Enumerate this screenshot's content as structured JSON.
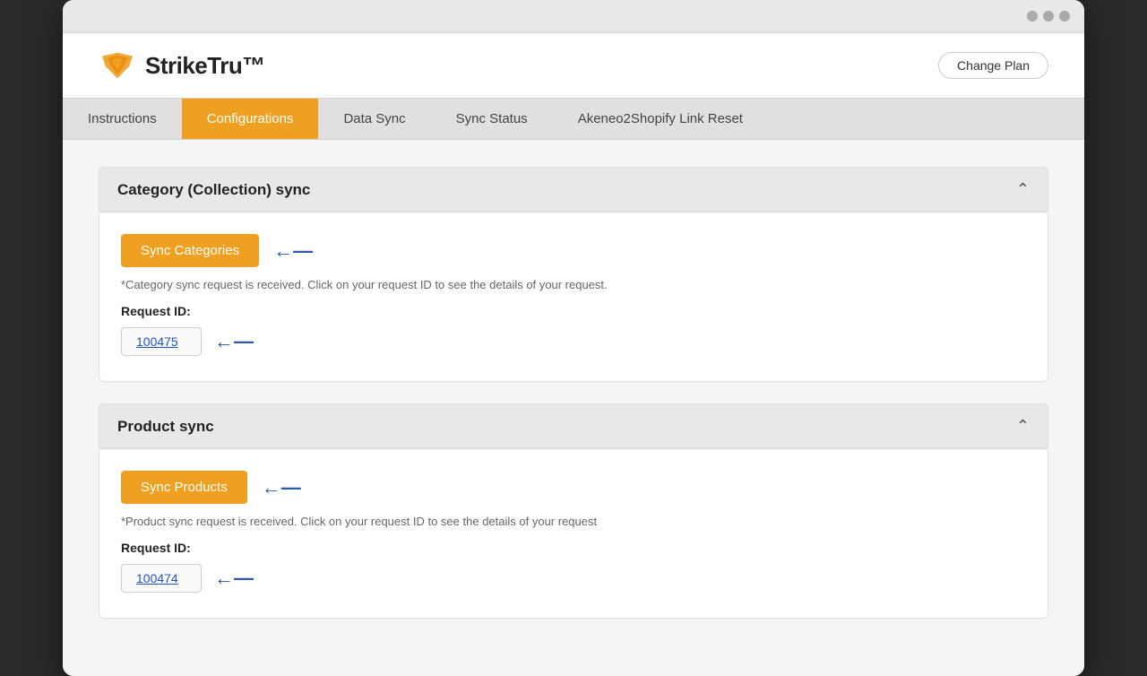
{
  "browser": {
    "dots": [
      "dot1",
      "dot2",
      "dot3"
    ]
  },
  "header": {
    "logo_text": "StrikeTru™",
    "change_plan_label": "Change Plan"
  },
  "nav": {
    "items": [
      {
        "id": "instructions",
        "label": "Instructions",
        "active": false
      },
      {
        "id": "configurations",
        "label": "Configurations",
        "active": true
      },
      {
        "id": "data-sync",
        "label": "Data Sync",
        "active": false
      },
      {
        "id": "sync-status",
        "label": "Sync Status",
        "active": false
      },
      {
        "id": "link-reset",
        "label": "Akeneo2Shopify Link Reset",
        "active": false
      }
    ]
  },
  "main": {
    "sections": [
      {
        "id": "category-sync",
        "title": "Category (Collection) sync",
        "button_label": "Sync Categories",
        "note": "*Category sync request is received. Click on your request ID to see the details of your request.",
        "request_label": "Request ID:",
        "request_id": "100475"
      },
      {
        "id": "product-sync",
        "title": "Product sync",
        "button_label": "Sync Products",
        "note": "*Product sync request is received. Click on your request ID to see the details of your request",
        "request_label": "Request ID:",
        "request_id": "100474"
      }
    ]
  }
}
